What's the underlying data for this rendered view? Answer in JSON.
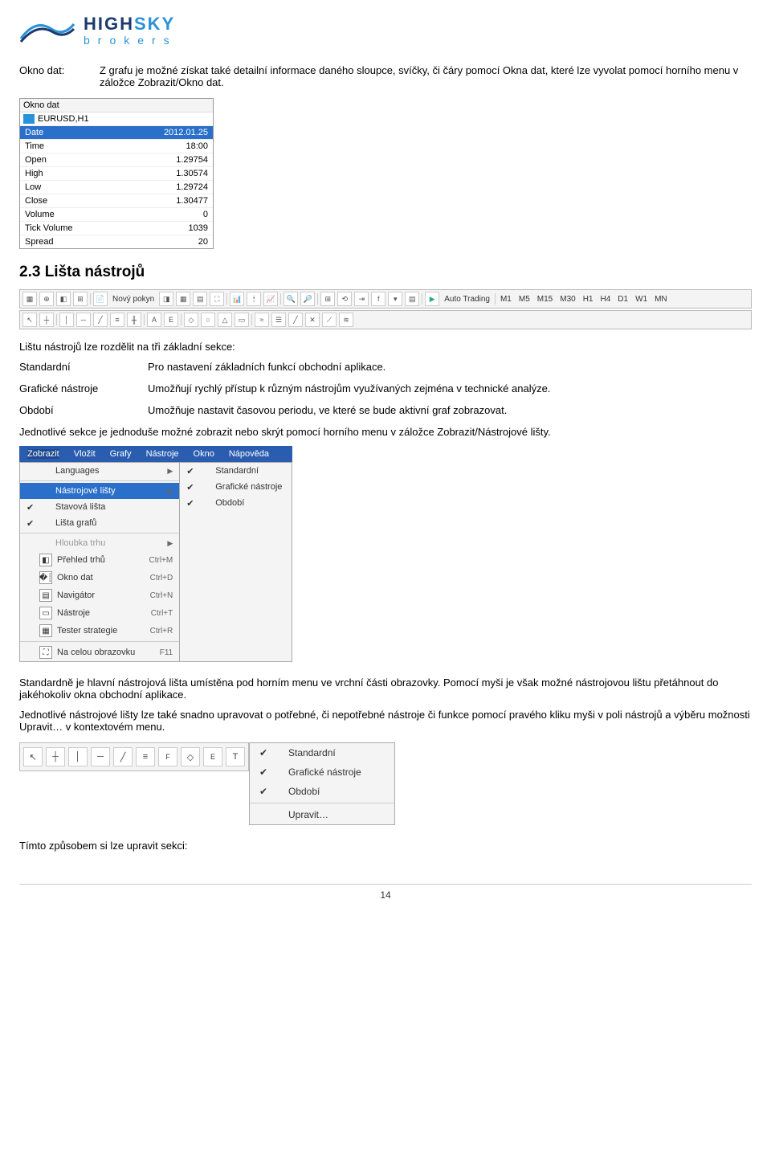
{
  "logo": {
    "main1": "HIGH",
    "main2": "SKY",
    "sub": "brokers"
  },
  "oknoDat": {
    "label": "Okno dat:",
    "desc": "Z grafu je možné získat také detailní informace daného sloupce, svíčky, či čáry pomocí Okna dat, které lze vyvolat pomocí horního menu v záložce Zobrazit/Okno dat.",
    "panelTitle": "Okno dat",
    "symbol": "EURUSD,H1",
    "rows": [
      {
        "k": "Date",
        "v": "2012.01.25",
        "hl": true
      },
      {
        "k": "Time",
        "v": "18:00"
      },
      {
        "k": "Open",
        "v": "1.29754"
      },
      {
        "k": "High",
        "v": "1.30574"
      },
      {
        "k": "Low",
        "v": "1.29724"
      },
      {
        "k": "Close",
        "v": "1.30477"
      },
      {
        "k": "Volume",
        "v": "0"
      },
      {
        "k": "Tick Volume",
        "v": "1039"
      },
      {
        "k": "Spread",
        "v": "20"
      }
    ]
  },
  "heading": "2.3 Lišta nástrojů",
  "toolbarBtns": {
    "newOrder": "Nový pokyn",
    "autoTrading": "Auto Trading",
    "periods": [
      "M1",
      "M5",
      "M15",
      "M30",
      "H1",
      "H4",
      "D1",
      "W1",
      "MN"
    ]
  },
  "intro": "Lištu nástrojů lze rozdělit na tři základní sekce:",
  "defs": [
    {
      "k": "Standardní",
      "v": "Pro nastavení základních funkcí obchodní aplikace."
    },
    {
      "k": "Grafické nástroje",
      "v": "Umožňují rychlý přístup k různým nástrojům využívaných zejména v technické  analýze."
    },
    {
      "k": "Období",
      "v": "Umožňuje nastavit časovou periodu, ve které se bude aktivní graf zobrazovat."
    }
  ],
  "afterDefs": "Jednotlivé sekce je jednoduše možné zobrazit nebo skrýt pomocí horního menu v záložce Zobrazit/Nástrojové lišty.",
  "menubar": [
    "Zobrazit",
    "Vložit",
    "Grafy",
    "Nástroje",
    "Okno",
    "Nápověda"
  ],
  "viewMenu": [
    {
      "t": "Languages",
      "arr": true
    },
    {
      "sep": true
    },
    {
      "t": "Nástrojové lišty",
      "arr": true,
      "hl": true
    },
    {
      "t": "Stavová lišta",
      "ck": true
    },
    {
      "t": "Lišta grafů",
      "ck": true
    },
    {
      "sep": true
    },
    {
      "t": "Hloubka trhu",
      "arr": true,
      "dis": true
    },
    {
      "t": "Přehled trhů",
      "ic": "◧",
      "sc": "Ctrl+M"
    },
    {
      "t": "Okno dat",
      "ic": "�┊",
      "sc": "Ctrl+D"
    },
    {
      "t": "Navigátor",
      "ic": "▤",
      "sc": "Ctrl+N"
    },
    {
      "t": "Nástroje",
      "ic": "▭",
      "sc": "Ctrl+T"
    },
    {
      "t": "Tester strategie",
      "ic": "▦",
      "sc": "Ctrl+R"
    },
    {
      "sep": true
    },
    {
      "t": "Na celou obrazovku",
      "ic": "⛶",
      "sc": "F11"
    }
  ],
  "subMenu": [
    {
      "t": "Standardní",
      "ck": true
    },
    {
      "t": "Grafické nástroje",
      "ck": true
    },
    {
      "t": "Období",
      "ck": true
    }
  ],
  "para1": "Standardně je hlavní nástrojová lišta umístěna pod horním menu ve vrchní části obrazovky. Pomocí myši je však možné nástrojovou lištu přetáhnout do jakéhokoliv okna obchodní aplikace.",
  "para2": "Jednotlivé nástrojové lišty lze také snadno upravovat o potřebné, či nepotřebné nástroje či funkce pomocí pravého kliku myši v poli nástrojů a výběru možnosti Upravit… v kontextovém menu.",
  "ctxMenu": [
    {
      "t": "Standardní",
      "ck": true
    },
    {
      "t": "Grafické nástroje",
      "ck": true
    },
    {
      "t": "Období",
      "ck": true
    },
    {
      "sep": true
    },
    {
      "t": "Upravit…"
    }
  ],
  "closing": "Tímto způsobem si lze upravit sekci:",
  "pageNum": "14"
}
